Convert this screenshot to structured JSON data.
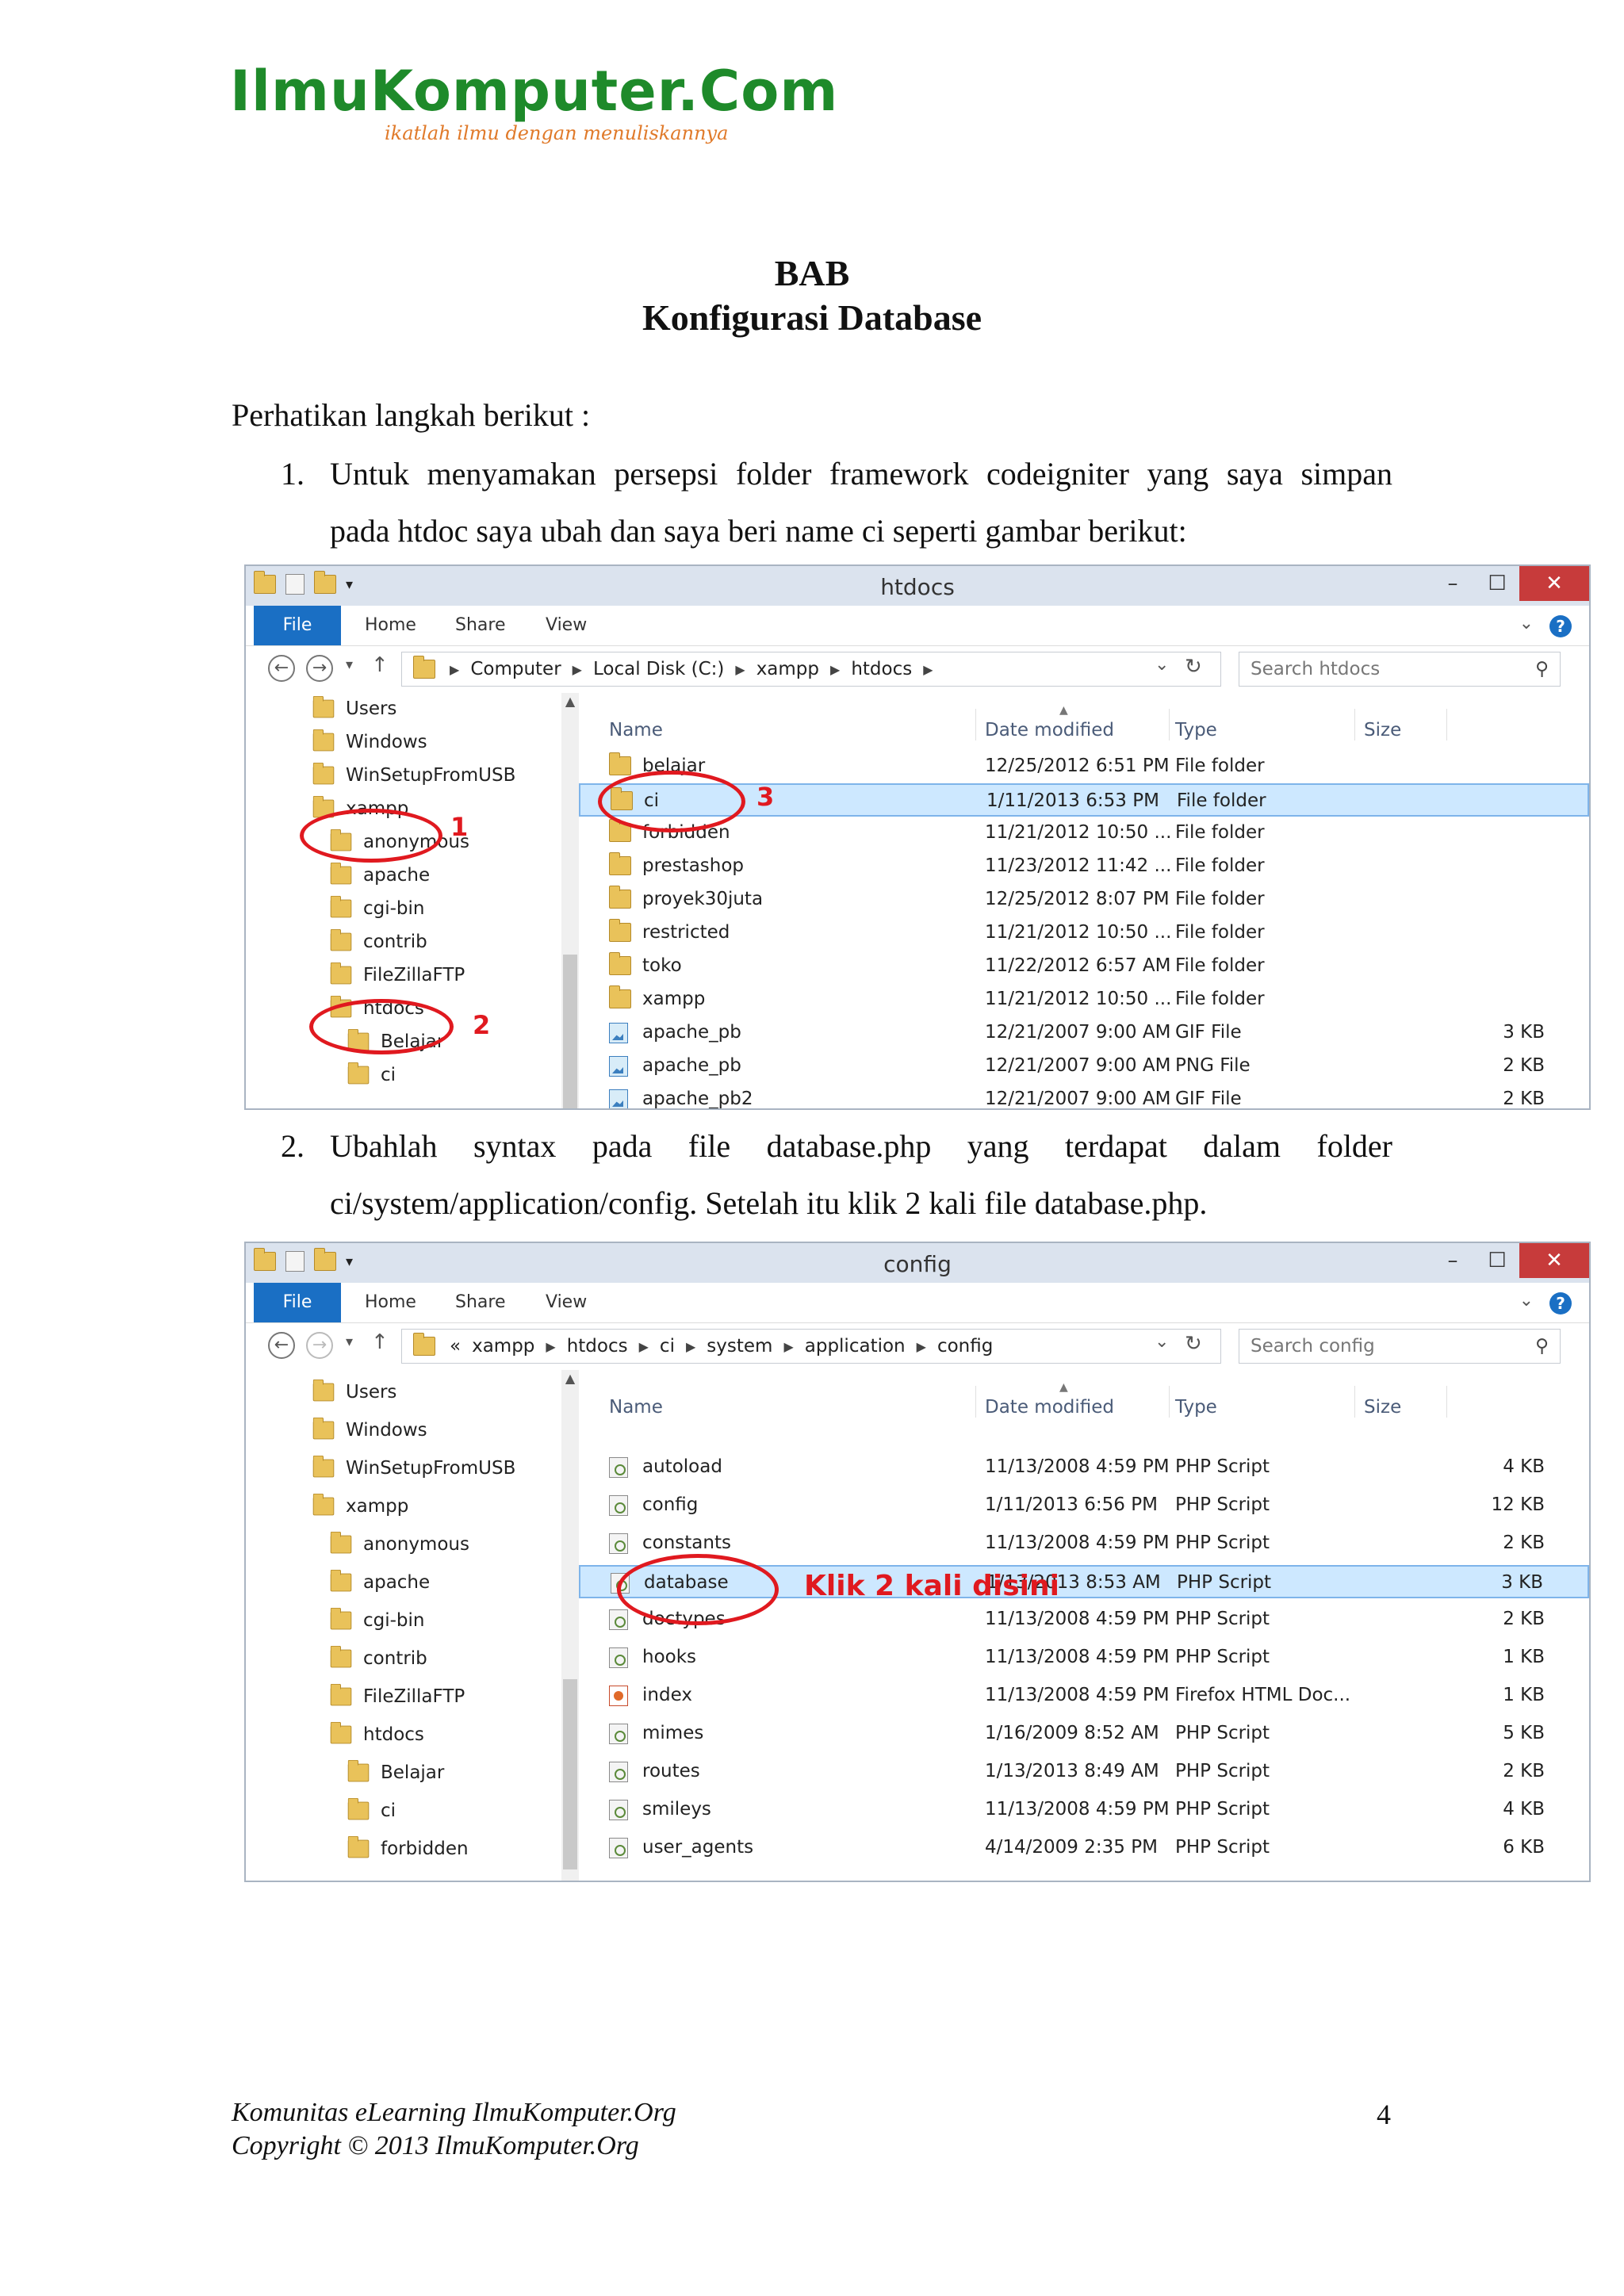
{
  "header": {
    "logo_text": "IlmuKomputer.Com",
    "logo_tagline": "ikatlah ilmu dengan menuliskannya"
  },
  "title": {
    "line1": "BAB",
    "line2": "Konfigurasi Database"
  },
  "intro": "Perhatikan langkah berikut :",
  "steps": [
    {
      "num": "1.",
      "line1": "Untuk menyamakan persepsi folder framework codeigniter yang saya simpan",
      "line2": "pada htdoc saya ubah dan saya beri name ci seperti gambar berikut:"
    },
    {
      "num": "2.",
      "line1": "Ubahlah syntax pada file database.php yang terdapat dalam folder",
      "line2": "ci/system/application/config. Setelah itu klik 2 kali file database.php."
    }
  ],
  "window1": {
    "caption": "htdocs",
    "tabs": [
      "File",
      "Home",
      "Share",
      "View"
    ],
    "breadcrumbs": [
      "Computer",
      "Local Disk (C:)",
      "xampp",
      "htdocs"
    ],
    "search_placeholder": "Search htdocs",
    "nav": [
      "Users",
      "Windows",
      "WinSetupFromUSB",
      "xampp",
      "anonymous",
      "apache",
      "cgi-bin",
      "contrib",
      "FileZillaFTP",
      "htdocs",
      "Belajar",
      "ci"
    ],
    "columns": [
      "Name",
      "Date modified",
      "Type",
      "Size"
    ],
    "rows": [
      {
        "name": "belajar",
        "date": "12/25/2012 6:51 PM",
        "type": "File folder",
        "size": ""
      },
      {
        "name": "ci",
        "date": "1/11/2013 6:53 PM",
        "type": "File folder",
        "size": ""
      },
      {
        "name": "forbidden",
        "date": "11/21/2012 10:50 ...",
        "type": "File folder",
        "size": ""
      },
      {
        "name": "prestashop",
        "date": "11/23/2012 11:42 ...",
        "type": "File folder",
        "size": ""
      },
      {
        "name": "proyek30juta",
        "date": "12/25/2012 8:07 PM",
        "type": "File folder",
        "size": ""
      },
      {
        "name": "restricted",
        "date": "11/21/2012 10:50 ...",
        "type": "File folder",
        "size": ""
      },
      {
        "name": "toko",
        "date": "11/22/2012 6:57 AM",
        "type": "File folder",
        "size": ""
      },
      {
        "name": "xampp",
        "date": "11/21/2012 10:50 ...",
        "type": "File folder",
        "size": ""
      },
      {
        "name": "apache_pb",
        "date": "12/21/2007 9:00 AM",
        "type": "GIF File",
        "size": "3 KB"
      },
      {
        "name": "apache_pb",
        "date": "12/21/2007 9:00 AM",
        "type": "PNG File",
        "size": "2 KB"
      },
      {
        "name": "apache_pb2",
        "date": "12/21/2007 9:00 AM",
        "type": "GIF File",
        "size": "2 KB"
      }
    ],
    "annotations": [
      "1",
      "2",
      "3"
    ]
  },
  "window2": {
    "caption": "config",
    "tabs": [
      "File",
      "Home",
      "Share",
      "View"
    ],
    "breadcrumbs": [
      "«",
      "xampp",
      "htdocs",
      "ci",
      "system",
      "application",
      "config"
    ],
    "search_placeholder": "Search config",
    "nav": [
      "Users",
      "Windows",
      "WinSetupFromUSB",
      "xampp",
      "anonymous",
      "apache",
      "cgi-bin",
      "contrib",
      "FileZillaFTP",
      "htdocs",
      "Belajar",
      "ci",
      "forbidden"
    ],
    "columns": [
      "Name",
      "Date modified",
      "Type",
      "Size"
    ],
    "rows": [
      {
        "name": "autoload",
        "date": "11/13/2008 4:59 PM",
        "type": "PHP Script",
        "size": "4 KB"
      },
      {
        "name": "config",
        "date": "1/11/2013 6:56 PM",
        "type": "PHP Script",
        "size": "12 KB"
      },
      {
        "name": "constants",
        "date": "11/13/2008 4:59 PM",
        "type": "PHP Script",
        "size": "2 KB"
      },
      {
        "name": "database",
        "date": "1/13/2013 8:53 AM",
        "type": "PHP Script",
        "size": "3 KB"
      },
      {
        "name": "doctypes",
        "date": "11/13/2008 4:59 PM",
        "type": "PHP Script",
        "size": "2 KB"
      },
      {
        "name": "hooks",
        "date": "11/13/2008 4:59 PM",
        "type": "PHP Script",
        "size": "1 KB"
      },
      {
        "name": "index",
        "date": "11/13/2008 4:59 PM",
        "type": "Firefox HTML Doc...",
        "size": "1 KB"
      },
      {
        "name": "mimes",
        "date": "1/16/2009 8:52 AM",
        "type": "PHP Script",
        "size": "5 KB"
      },
      {
        "name": "routes",
        "date": "1/13/2013 8:49 AM",
        "type": "PHP Script",
        "size": "2 KB"
      },
      {
        "name": "smileys",
        "date": "11/13/2008 4:59 PM",
        "type": "PHP Script",
        "size": "4 KB"
      },
      {
        "name": "user_agents",
        "date": "4/14/2009 2:35 PM",
        "type": "PHP Script",
        "size": "6 KB"
      }
    ],
    "annotation": "Klik 2 kali disini"
  },
  "footer": {
    "line1": "Komunitas eLearning IlmuKomputer.Org",
    "line2": "Copyright © 2013 IlmuKomputer.Org",
    "page": "4"
  },
  "colors": {
    "brand_green": "#1e8a2a",
    "annotation_red": "#e0191f",
    "selection_blue": "#cde8ff",
    "file_tab_blue": "#1a6fc4"
  }
}
